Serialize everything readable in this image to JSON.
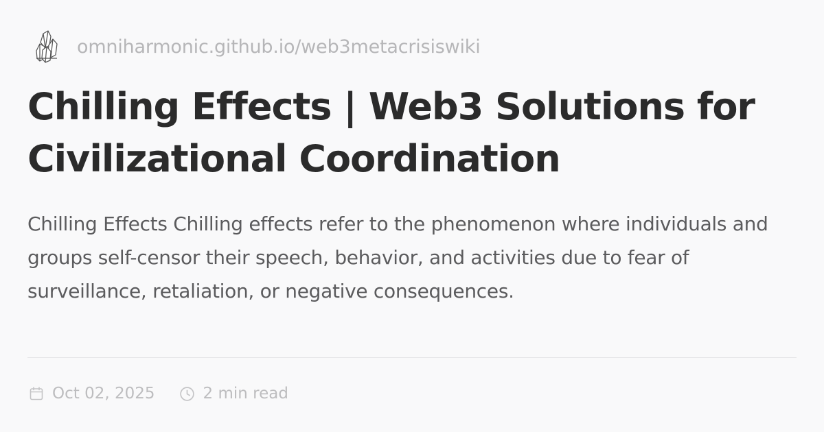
{
  "site": {
    "logo_icon": "crystal-cluster-icon",
    "url": "omniharmonic.github.io/web3metacrisiswiki"
  },
  "page": {
    "title": "Chilling Effects | Web3 Solutions for Civilizational Coordination",
    "description": "Chilling Effects Chilling effects refer to the phenomenon where individuals and groups self-censor their speech, behavior, and activities due to fear of surveillance, retaliation, or negative consequences."
  },
  "meta": {
    "date_icon": "calendar-icon",
    "date": "Oct 02, 2025",
    "read_time_icon": "clock-icon",
    "read_time": "2 min read"
  },
  "colors": {
    "background": "#f9f9fa",
    "title": "#2b2b2b",
    "description": "#5b5b5d",
    "muted": "#bdbdbf",
    "divider": "#e5e5e7"
  }
}
